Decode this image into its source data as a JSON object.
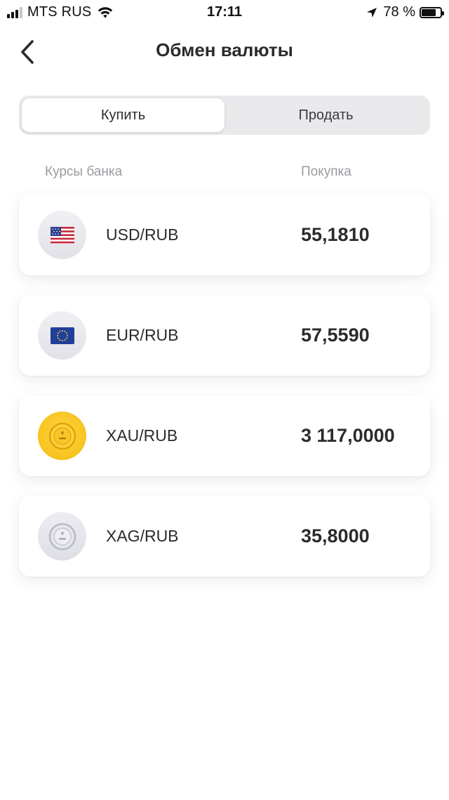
{
  "status_bar": {
    "carrier": "MTS RUS",
    "time": "17:11",
    "battery": "78 %",
    "battery_level": 0.78
  },
  "header": {
    "title": "Обмен валюты",
    "back_icon": "chevron-left-icon"
  },
  "tabs": [
    {
      "label": "Купить",
      "active": true
    },
    {
      "label": "Продать",
      "active": false
    }
  ],
  "columns": {
    "left": "Курсы банка",
    "right": "Покупка"
  },
  "rates": [
    {
      "pair": "USD/RUB",
      "value": "55,1810",
      "icon": "us-flag-icon"
    },
    {
      "pair": "EUR/RUB",
      "value": "57,5590",
      "icon": "eu-flag-icon"
    },
    {
      "pair": "XAU/RUB",
      "value": "3 117,0000",
      "icon": "gold-coin-icon"
    },
    {
      "pair": "XAG/RUB",
      "value": "35,8000",
      "icon": "silver-coin-icon"
    }
  ],
  "colors": {
    "gold": "#f7c21e",
    "silver": "#c9c9d6",
    "text": "#2b2b2b",
    "muted": "#9a9aa0"
  }
}
